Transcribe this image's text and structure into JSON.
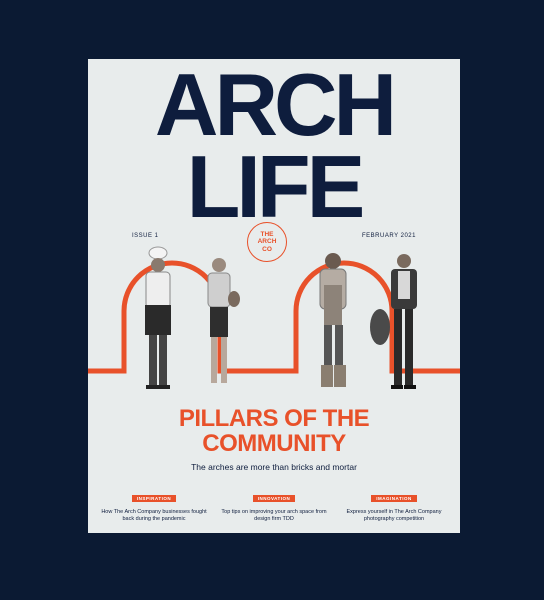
{
  "masthead": {
    "line1": "ARCH",
    "line2": "LIFE"
  },
  "issue": "ISSUE 1",
  "date": "FEBRUARY 2021",
  "seal": {
    "line1": "THE",
    "line2": "ARCH",
    "line3": "CO"
  },
  "headline": {
    "line1": "PILLARS OF THE",
    "line2": "COMMUNITY"
  },
  "subheadline": "The arches are more than bricks and mortar",
  "teasers": [
    {
      "tag": "INSPIRATION",
      "text": "How The Arch Company businesses fought back during the pandemic"
    },
    {
      "tag": "INNOVATION",
      "text": "Top tips on improving your arch space from design firm TDD"
    },
    {
      "tag": "IMAGINATION",
      "text": "Express yourself in The Arch Company photography competition"
    }
  ],
  "colors": {
    "background": "#0b1a33",
    "cover": "#e8ecec",
    "accent": "#e8512a",
    "ink": "#0e1d3d"
  }
}
